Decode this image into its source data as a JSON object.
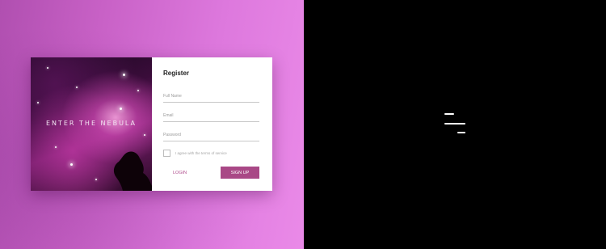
{
  "hero": {
    "tagline": "ENTER THE NEBULA"
  },
  "form": {
    "title": "Register",
    "fullname_placeholder": "Full Name",
    "email_placeholder": "Email",
    "password_placeholder": "Password",
    "agree_label": "I agree with the terms of service",
    "agree_checked": false,
    "login_label": "LOGIN",
    "signup_label": "SIGN UP"
  },
  "colors": {
    "accent": "#a94886",
    "login_text": "#b04f8e",
    "right_bg": "#000000"
  },
  "icons": {
    "menu": "menu-lines-icon"
  }
}
